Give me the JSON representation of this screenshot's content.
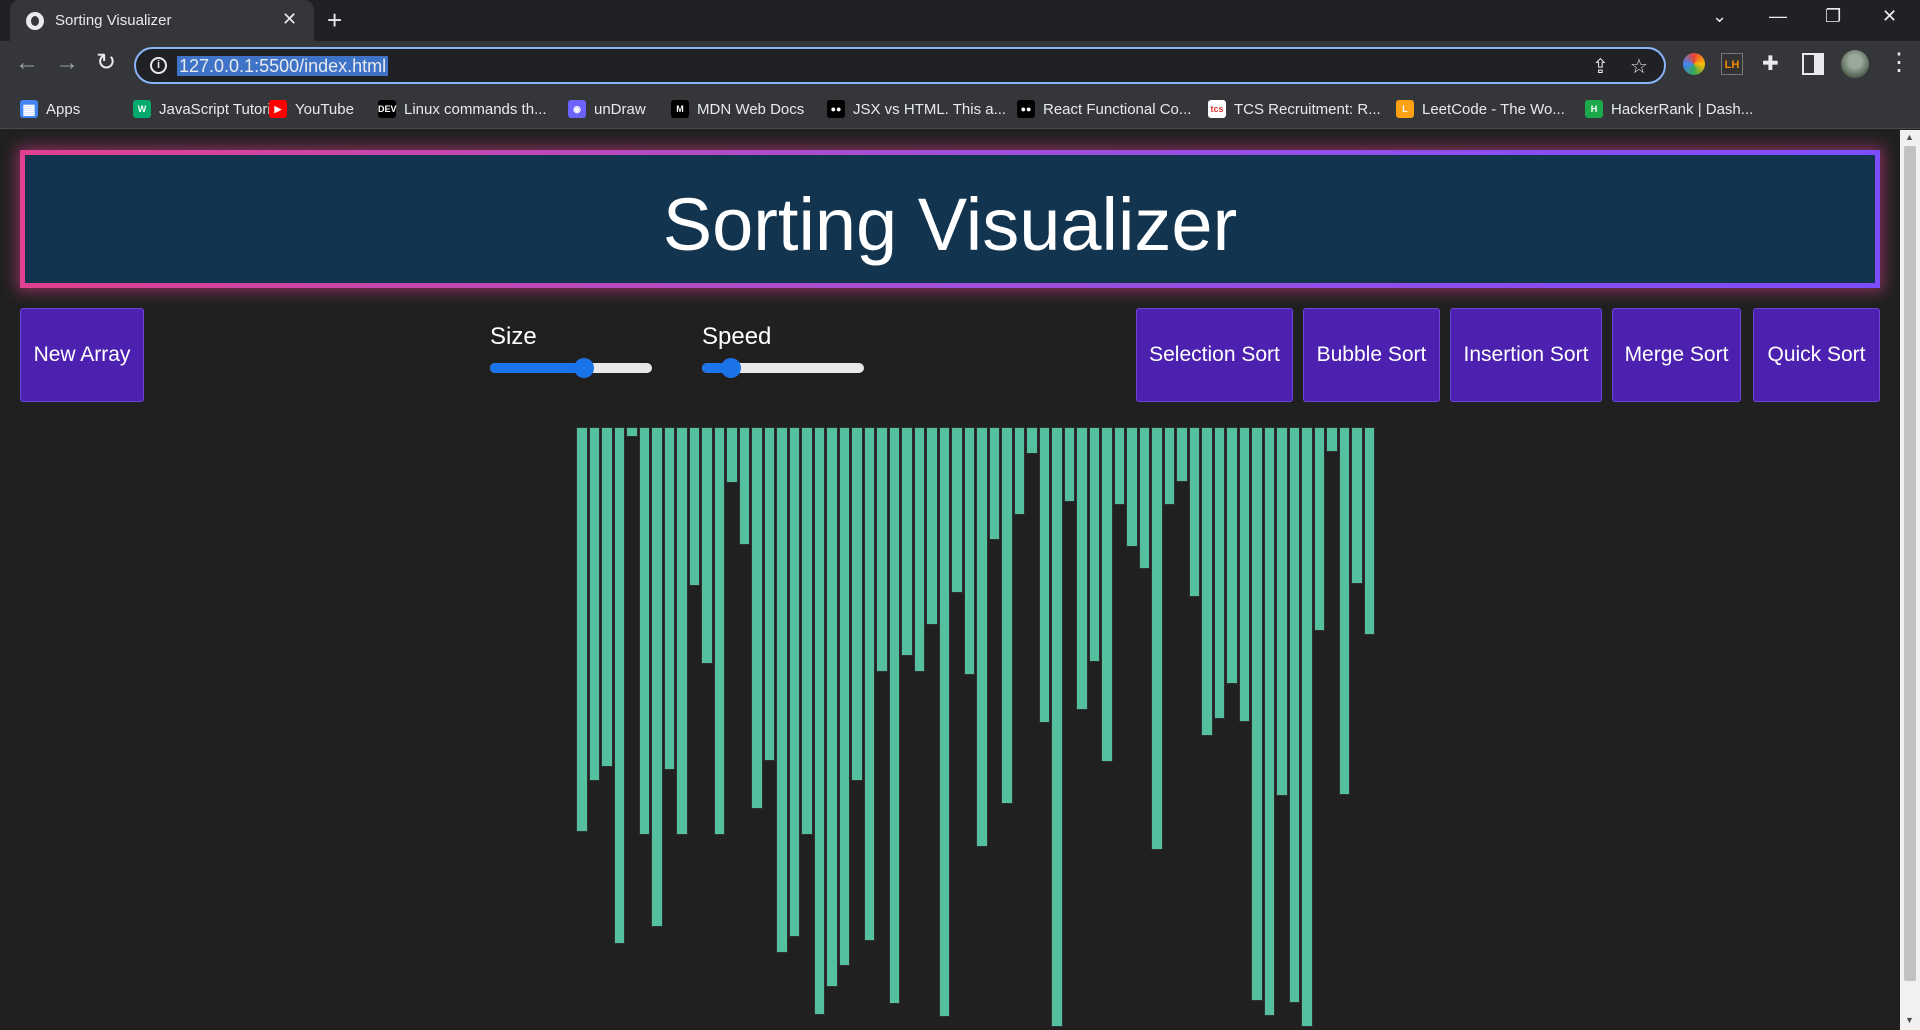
{
  "browser": {
    "tab_title": "Sorting Visualizer",
    "tab_close": "✕",
    "new_tab": "+",
    "url": "127.0.0.1:5500/index.html",
    "controls": {
      "dropdown": "⌄",
      "minimize": "—",
      "restore": "❐",
      "close": "✕"
    },
    "nav": {
      "back": "←",
      "forward": "→",
      "reload": "↻"
    },
    "omnibox_icons": {
      "share": "⇪",
      "star": "☆"
    },
    "menu": "⋮"
  },
  "bookmarks": [
    {
      "label": "Apps",
      "icon": "apps-icon",
      "color": "#4285f4"
    },
    {
      "label": "JavaScript Tutorial",
      "icon": "w3schools-icon",
      "color": "#04aa6d"
    },
    {
      "label": "YouTube",
      "icon": "youtube-icon",
      "color": "#ff0000"
    },
    {
      "label": "Linux commands th...",
      "icon": "dev-icon",
      "color": "#000000"
    },
    {
      "label": "unDraw",
      "icon": "undraw-icon",
      "color": "#6c63ff"
    },
    {
      "label": "MDN Web Docs",
      "icon": "mdn-icon",
      "color": "#000000"
    },
    {
      "label": "JSX vs HTML. This a...",
      "icon": "medium-icon",
      "color": "#000000"
    },
    {
      "label": "React Functional Co...",
      "icon": "medium-icon",
      "color": "#000000"
    },
    {
      "label": "TCS Recruitment: R...",
      "icon": "tcs-icon",
      "color": "#ffffff"
    },
    {
      "label": "LeetCode - The Wo...",
      "icon": "leetcode-icon",
      "color": "#ffa116"
    },
    {
      "label": "HackerRank | Dash...",
      "icon": "hackerrank-icon",
      "color": "#1ba94c"
    }
  ],
  "app": {
    "title": "Sorting Visualizer",
    "new_array_label": "New Array",
    "size_label": "Size",
    "speed_label": "Speed",
    "size_value": 0.58,
    "speed_value": 0.18,
    "algorithms": [
      "Selection Sort",
      "Bubble Sort",
      "Insertion Sort",
      "Merge Sort",
      "Quick Sort"
    ],
    "bar_color": "#55c0a0",
    "button_color": "#4c21b0",
    "header_color": "#12344f",
    "bars": [
      405,
      354,
      340,
      517,
      10,
      408,
      500,
      343,
      408,
      159,
      237,
      408,
      56,
      118,
      382,
      334,
      526,
      510,
      408,
      588,
      560,
      539,
      354,
      514,
      245,
      577,
      229,
      245,
      198,
      590,
      166,
      248,
      420,
      113,
      377,
      88,
      27,
      296,
      600,
      75,
      283,
      235,
      335,
      78,
      120,
      142,
      423,
      78,
      55,
      170,
      309,
      292,
      257,
      295,
      574,
      589,
      369,
      576,
      600,
      204,
      25,
      368,
      157,
      208
    ]
  }
}
